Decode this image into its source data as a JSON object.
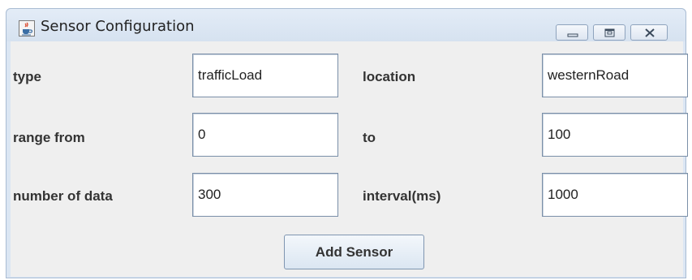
{
  "window": {
    "title": "Sensor Configuration",
    "controls": [
      "minimize",
      "maximize",
      "close"
    ],
    "app_icon": "java-cup-icon"
  },
  "form": {
    "type_label": "type",
    "type_value": "trafficLoad",
    "location_label": "location",
    "location_value": "westernRoad",
    "range_from_label": "range from",
    "range_from_value": "0",
    "to_label": "to",
    "to_value": "100",
    "number_label": "number of data",
    "number_value": "300",
    "interval_label": "interval(ms)",
    "interval_value": "1000"
  },
  "actions": {
    "add_sensor_label": "Add Sensor"
  },
  "colors": {
    "frame": "#dbe6f3",
    "panel": "#efefef",
    "field_border": "#7a8fa8",
    "button_gradient_top": "#f3f7fb",
    "button_gradient_bottom": "#dbe6f2"
  }
}
